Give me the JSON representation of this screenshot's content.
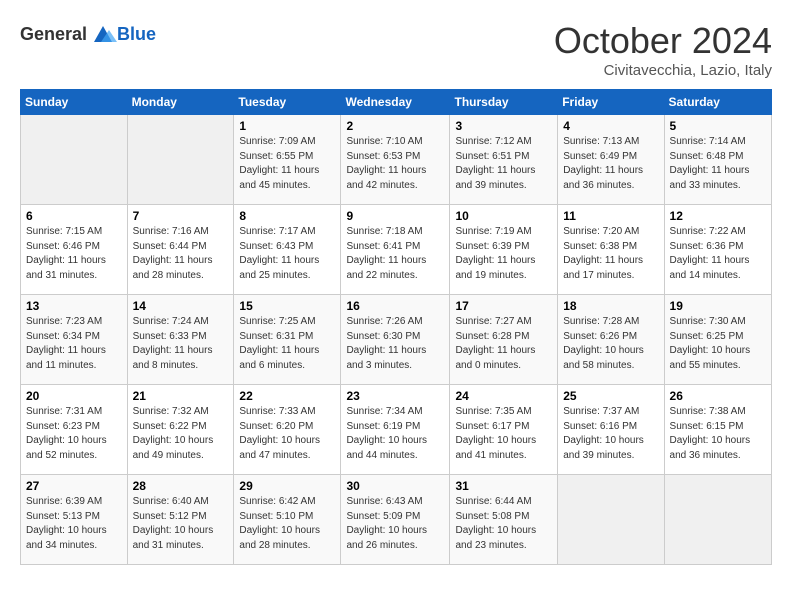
{
  "header": {
    "logo_general": "General",
    "logo_blue": "Blue",
    "month": "October 2024",
    "location": "Civitavecchia, Lazio, Italy"
  },
  "days_of_week": [
    "Sunday",
    "Monday",
    "Tuesday",
    "Wednesday",
    "Thursday",
    "Friday",
    "Saturday"
  ],
  "weeks": [
    [
      {
        "day": "",
        "empty": true
      },
      {
        "day": "",
        "empty": true
      },
      {
        "day": "1",
        "sunrise": "Sunrise: 7:09 AM",
        "sunset": "Sunset: 6:55 PM",
        "daylight": "Daylight: 11 hours and 45 minutes."
      },
      {
        "day": "2",
        "sunrise": "Sunrise: 7:10 AM",
        "sunset": "Sunset: 6:53 PM",
        "daylight": "Daylight: 11 hours and 42 minutes."
      },
      {
        "day": "3",
        "sunrise": "Sunrise: 7:12 AM",
        "sunset": "Sunset: 6:51 PM",
        "daylight": "Daylight: 11 hours and 39 minutes."
      },
      {
        "day": "4",
        "sunrise": "Sunrise: 7:13 AM",
        "sunset": "Sunset: 6:49 PM",
        "daylight": "Daylight: 11 hours and 36 minutes."
      },
      {
        "day": "5",
        "sunrise": "Sunrise: 7:14 AM",
        "sunset": "Sunset: 6:48 PM",
        "daylight": "Daylight: 11 hours and 33 minutes."
      }
    ],
    [
      {
        "day": "6",
        "sunrise": "Sunrise: 7:15 AM",
        "sunset": "Sunset: 6:46 PM",
        "daylight": "Daylight: 11 hours and 31 minutes."
      },
      {
        "day": "7",
        "sunrise": "Sunrise: 7:16 AM",
        "sunset": "Sunset: 6:44 PM",
        "daylight": "Daylight: 11 hours and 28 minutes."
      },
      {
        "day": "8",
        "sunrise": "Sunrise: 7:17 AM",
        "sunset": "Sunset: 6:43 PM",
        "daylight": "Daylight: 11 hours and 25 minutes."
      },
      {
        "day": "9",
        "sunrise": "Sunrise: 7:18 AM",
        "sunset": "Sunset: 6:41 PM",
        "daylight": "Daylight: 11 hours and 22 minutes."
      },
      {
        "day": "10",
        "sunrise": "Sunrise: 7:19 AM",
        "sunset": "Sunset: 6:39 PM",
        "daylight": "Daylight: 11 hours and 19 minutes."
      },
      {
        "day": "11",
        "sunrise": "Sunrise: 7:20 AM",
        "sunset": "Sunset: 6:38 PM",
        "daylight": "Daylight: 11 hours and 17 minutes."
      },
      {
        "day": "12",
        "sunrise": "Sunrise: 7:22 AM",
        "sunset": "Sunset: 6:36 PM",
        "daylight": "Daylight: 11 hours and 14 minutes."
      }
    ],
    [
      {
        "day": "13",
        "sunrise": "Sunrise: 7:23 AM",
        "sunset": "Sunset: 6:34 PM",
        "daylight": "Daylight: 11 hours and 11 minutes."
      },
      {
        "day": "14",
        "sunrise": "Sunrise: 7:24 AM",
        "sunset": "Sunset: 6:33 PM",
        "daylight": "Daylight: 11 hours and 8 minutes."
      },
      {
        "day": "15",
        "sunrise": "Sunrise: 7:25 AM",
        "sunset": "Sunset: 6:31 PM",
        "daylight": "Daylight: 11 hours and 6 minutes."
      },
      {
        "day": "16",
        "sunrise": "Sunrise: 7:26 AM",
        "sunset": "Sunset: 6:30 PM",
        "daylight": "Daylight: 11 hours and 3 minutes."
      },
      {
        "day": "17",
        "sunrise": "Sunrise: 7:27 AM",
        "sunset": "Sunset: 6:28 PM",
        "daylight": "Daylight: 11 hours and 0 minutes."
      },
      {
        "day": "18",
        "sunrise": "Sunrise: 7:28 AM",
        "sunset": "Sunset: 6:26 PM",
        "daylight": "Daylight: 10 hours and 58 minutes."
      },
      {
        "day": "19",
        "sunrise": "Sunrise: 7:30 AM",
        "sunset": "Sunset: 6:25 PM",
        "daylight": "Daylight: 10 hours and 55 minutes."
      }
    ],
    [
      {
        "day": "20",
        "sunrise": "Sunrise: 7:31 AM",
        "sunset": "Sunset: 6:23 PM",
        "daylight": "Daylight: 10 hours and 52 minutes."
      },
      {
        "day": "21",
        "sunrise": "Sunrise: 7:32 AM",
        "sunset": "Sunset: 6:22 PM",
        "daylight": "Daylight: 10 hours and 49 minutes."
      },
      {
        "day": "22",
        "sunrise": "Sunrise: 7:33 AM",
        "sunset": "Sunset: 6:20 PM",
        "daylight": "Daylight: 10 hours and 47 minutes."
      },
      {
        "day": "23",
        "sunrise": "Sunrise: 7:34 AM",
        "sunset": "Sunset: 6:19 PM",
        "daylight": "Daylight: 10 hours and 44 minutes."
      },
      {
        "day": "24",
        "sunrise": "Sunrise: 7:35 AM",
        "sunset": "Sunset: 6:17 PM",
        "daylight": "Daylight: 10 hours and 41 minutes."
      },
      {
        "day": "25",
        "sunrise": "Sunrise: 7:37 AM",
        "sunset": "Sunset: 6:16 PM",
        "daylight": "Daylight: 10 hours and 39 minutes."
      },
      {
        "day": "26",
        "sunrise": "Sunrise: 7:38 AM",
        "sunset": "Sunset: 6:15 PM",
        "daylight": "Daylight: 10 hours and 36 minutes."
      }
    ],
    [
      {
        "day": "27",
        "sunrise": "Sunrise: 6:39 AM",
        "sunset": "Sunset: 5:13 PM",
        "daylight": "Daylight: 10 hours and 34 minutes."
      },
      {
        "day": "28",
        "sunrise": "Sunrise: 6:40 AM",
        "sunset": "Sunset: 5:12 PM",
        "daylight": "Daylight: 10 hours and 31 minutes."
      },
      {
        "day": "29",
        "sunrise": "Sunrise: 6:42 AM",
        "sunset": "Sunset: 5:10 PM",
        "daylight": "Daylight: 10 hours and 28 minutes."
      },
      {
        "day": "30",
        "sunrise": "Sunrise: 6:43 AM",
        "sunset": "Sunset: 5:09 PM",
        "daylight": "Daylight: 10 hours and 26 minutes."
      },
      {
        "day": "31",
        "sunrise": "Sunrise: 6:44 AM",
        "sunset": "Sunset: 5:08 PM",
        "daylight": "Daylight: 10 hours and 23 minutes."
      },
      {
        "day": "",
        "empty": true
      },
      {
        "day": "",
        "empty": true
      }
    ]
  ]
}
